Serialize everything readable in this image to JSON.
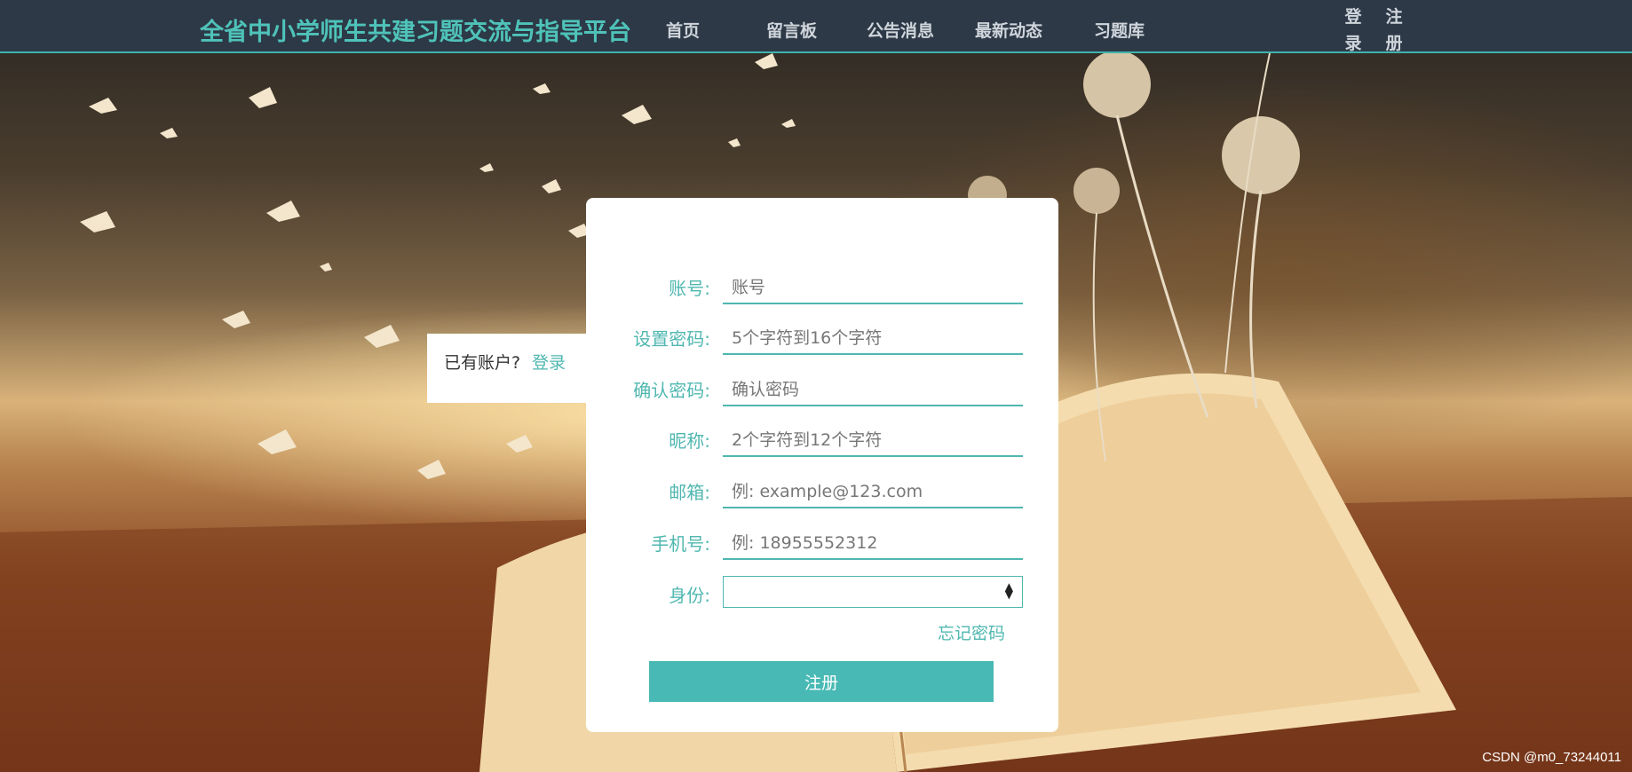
{
  "nav": {
    "site_title": "全省中小学师生共建习题交流与指导平台",
    "links": [
      "首页",
      "留言板",
      "公告消息",
      "最新动态",
      "习题库"
    ],
    "login": "登录",
    "register": "注册"
  },
  "side_panel": {
    "have_account": "已有账户?",
    "login_link": "登录"
  },
  "form": {
    "fields": [
      {
        "label": "账号:",
        "placeholder": "账号"
      },
      {
        "label": "设置密码:",
        "placeholder": "5个字符到16个字符"
      },
      {
        "label": "确认密码:",
        "placeholder": "确认密码"
      },
      {
        "label": "昵称:",
        "placeholder": "2个字符到12个字符"
      },
      {
        "label": "邮箱:",
        "placeholder": "例: example@123.com"
      },
      {
        "label": "手机号:",
        "placeholder": "例: 18955552312"
      }
    ],
    "identity_label": "身份:",
    "identity_value": "",
    "forgot_password": "忘记密码",
    "submit": "注册"
  },
  "watermark": "CSDN @m0_73244011",
  "colors": {
    "nav_bg": "#2d3947",
    "accent": "#4fb7b0",
    "button": "#48b9b4"
  }
}
